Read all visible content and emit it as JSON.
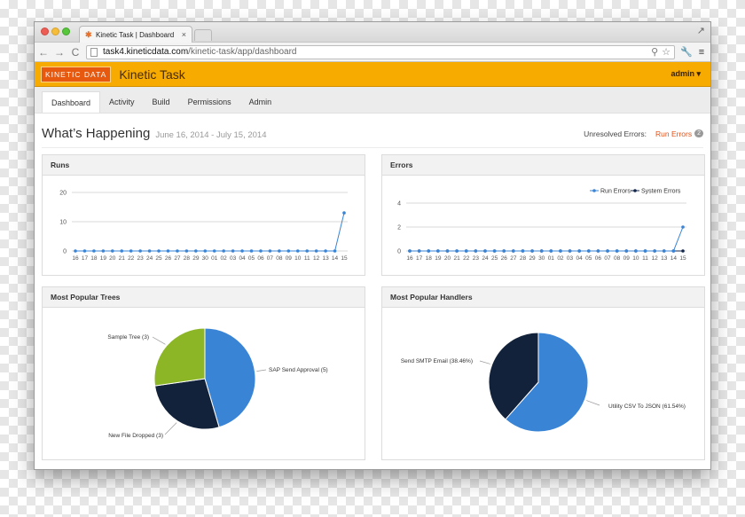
{
  "browser": {
    "tab_title": "Kinetic Task | Dashboard",
    "tab_close": "×",
    "url_host": "task4.kineticdata.com",
    "url_path": "/kinetic-task/app/dashboard",
    "back_icon": "←",
    "forward_icon": "→",
    "reload_icon": "C",
    "menu_icon": "≡"
  },
  "app": {
    "logo": "KINETIC DATA",
    "title": "Kinetic Task",
    "user": "admin ▾",
    "brand_color": "#f7aa00"
  },
  "nav": {
    "tabs": [
      "Dashboard",
      "Activity",
      "Build",
      "Permissions",
      "Admin"
    ],
    "active": "Dashboard"
  },
  "header": {
    "title": "What’s Happening",
    "date_range": "June 16, 2014 - July 15, 2014",
    "errors_label": "Unresolved Errors:",
    "errors_link": "Run Errors",
    "errors_count": "2"
  },
  "panels": {
    "runs": "Runs",
    "errors": "Errors",
    "trees": "Most Popular Trees",
    "handlers": "Most Popular Handlers"
  },
  "chart_data": [
    {
      "type": "line",
      "title": "Runs",
      "x": [
        "16",
        "17",
        "18",
        "19",
        "20",
        "21",
        "22",
        "23",
        "24",
        "25",
        "26",
        "27",
        "28",
        "29",
        "30",
        "01",
        "02",
        "03",
        "04",
        "05",
        "06",
        "07",
        "08",
        "09",
        "10",
        "11",
        "12",
        "13",
        "14",
        "15"
      ],
      "series": [
        {
          "values": [
            0,
            0,
            0,
            0,
            0,
            0,
            0,
            0,
            0,
            0,
            0,
            0,
            0,
            0,
            0,
            0,
            0,
            0,
            0,
            0,
            0,
            0,
            0,
            0,
            0,
            0,
            0,
            0,
            0,
            13
          ],
          "color": "#3a84d6"
        }
      ],
      "yticks": [
        0,
        10,
        20
      ],
      "ylim": [
        0,
        20
      ],
      "grid": true
    },
    {
      "type": "line",
      "title": "Errors",
      "x": [
        "16",
        "17",
        "18",
        "19",
        "20",
        "21",
        "22",
        "23",
        "24",
        "25",
        "26",
        "27",
        "28",
        "29",
        "30",
        "01",
        "02",
        "03",
        "04",
        "05",
        "06",
        "07",
        "08",
        "09",
        "10",
        "11",
        "12",
        "13",
        "14",
        "15"
      ],
      "series": [
        {
          "name": "Run Errors",
          "values": [
            0,
            0,
            0,
            0,
            0,
            0,
            0,
            0,
            0,
            0,
            0,
            0,
            0,
            0,
            0,
            0,
            0,
            0,
            0,
            0,
            0,
            0,
            0,
            0,
            0,
            0,
            0,
            0,
            0,
            2
          ],
          "color": "#3a84d6"
        },
        {
          "name": "System Errors",
          "values": [
            0,
            0,
            0,
            0,
            0,
            0,
            0,
            0,
            0,
            0,
            0,
            0,
            0,
            0,
            0,
            0,
            0,
            0,
            0,
            0,
            0,
            0,
            0,
            0,
            0,
            0,
            0,
            0,
            0,
            0
          ],
          "color": "#12264a"
        }
      ],
      "yticks": [
        0,
        2,
        4
      ],
      "ylim": [
        0,
        4
      ],
      "grid": true,
      "legend": "top-right"
    },
    {
      "type": "pie",
      "title": "Most Popular Trees",
      "slices": [
        {
          "label": "SAP Send Approval (5)",
          "value": 5,
          "color": "#3a84d6"
        },
        {
          "label": "New File Dropped (3)",
          "value": 3,
          "color": "#12223b"
        },
        {
          "label": "Sample Tree (3)",
          "value": 3,
          "color": "#8cb626"
        }
      ]
    },
    {
      "type": "pie",
      "title": "Most Popular Handlers",
      "slices": [
        {
          "label": "Utility CSV To JSON (61.54%)",
          "value": 61.54,
          "color": "#3a84d6"
        },
        {
          "label": "Send SMTP Email (38.46%)",
          "value": 38.46,
          "color": "#12223b"
        }
      ]
    }
  ]
}
